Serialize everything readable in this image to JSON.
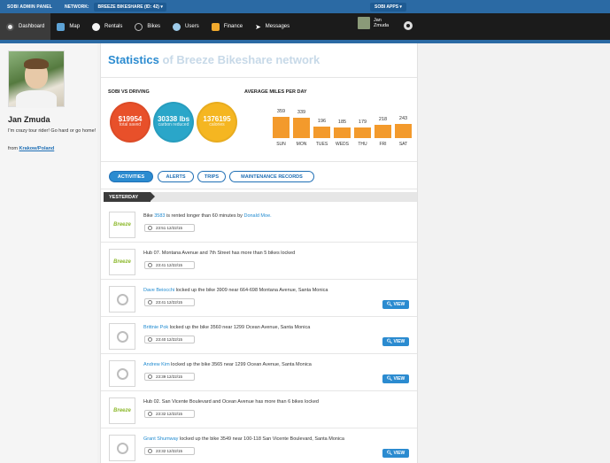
{
  "topbar": {
    "admin_label": "SOBI ADMIN PANEL",
    "network_label": "NETWORK:",
    "network_value": "BREEZE BIKESHARE (ID: 42) ▾",
    "apps_label": "SOBI APPS ▾"
  },
  "nav": {
    "items": [
      {
        "label": "Dashboard",
        "icon": "dashboard-icon"
      },
      {
        "label": "Map",
        "icon": "map-icon"
      },
      {
        "label": "Rentals",
        "icon": "rentals-icon"
      },
      {
        "label": "Bikes",
        "icon": "bike-icon"
      },
      {
        "label": "Users",
        "icon": "users-icon"
      },
      {
        "label": "Finance",
        "icon": "finance-icon"
      },
      {
        "label": "Messages",
        "icon": "messages-icon"
      }
    ],
    "user_first": "Jan",
    "user_last": "Zmuda"
  },
  "profile": {
    "name": "Jan Zmuda",
    "bio": "I'm crazy tour rider! Go hard or go home!",
    "from_label": "from",
    "from_link": "Krakow/Poland"
  },
  "stats": {
    "title": "Statistics",
    "subtitle": "of Breeze Bikeshare network",
    "sobi_label": "SOBI VS DRIVING",
    "circles": [
      {
        "num": "$19954",
        "label": "total saved",
        "color": "#e8502a"
      },
      {
        "num": "30338 lbs",
        "label": "carbon reduced",
        "color": "#2aa6c9"
      },
      {
        "num": "1376195",
        "label": "calories",
        "color": "#f5b621"
      }
    ],
    "miles_label": "AVERAGE MILES PER DAY"
  },
  "chart_data": {
    "type": "bar",
    "title": "AVERAGE MILES PER DAY",
    "categories": [
      "SUN",
      "MON",
      "TUES",
      "WEDS",
      "THU",
      "FRI",
      "SAT"
    ],
    "values": [
      359,
      339,
      196,
      185,
      179,
      218,
      243
    ],
    "ylim": [
      0,
      359
    ]
  },
  "tabs": {
    "activities": "ACTIVITIES",
    "alerts": "ALERTS",
    "trips": "TRIPS",
    "maintenance": "MAINTENANCE RECORDS"
  },
  "feed": {
    "group_label": "YESTERDAY",
    "view_label": "VIEW",
    "logo_text": "Breeze",
    "items": [
      {
        "link": "",
        "pre": "Bike ",
        "link_a": "3583",
        "mid": " is rented longer than 60 minutes by ",
        "link_b": "Donald Moe.",
        "post": "",
        "time": "23:51 12/22/15"
      },
      {
        "pre": "Hub 07. Montana Avenue and 7th Street has more than 5 bikes locked",
        "time": "23:41 12/22/15"
      },
      {
        "link": "Dave Beiocchi",
        "text": " locked up the bike 3909 near 664-698 Montana Avenue, Santa Monica",
        "time": "23:41 12/22/15"
      },
      {
        "link": "Brittnie Pok",
        "text": " locked up the bike 3560 near 1299 Ocean Avenue, Santa Monica",
        "time": "23:40 12/22/15"
      },
      {
        "link": "Andrew Kim",
        "text": " locked up the bike 3565 near 1299 Ocean Avenue, Santa Monica",
        "time": "23:39 12/22/15"
      },
      {
        "pre": "Hub 02. San Vicente Boulevard and Ocean Avenue has more than 6 bikes locked",
        "time": "23:32 12/22/15"
      },
      {
        "link": "Grant Shumway",
        "text": " locked up the bike 3549 near 100-118 San Vicente Boulevard, Santa Monica",
        "time": "23:32 12/22/15"
      }
    ]
  }
}
